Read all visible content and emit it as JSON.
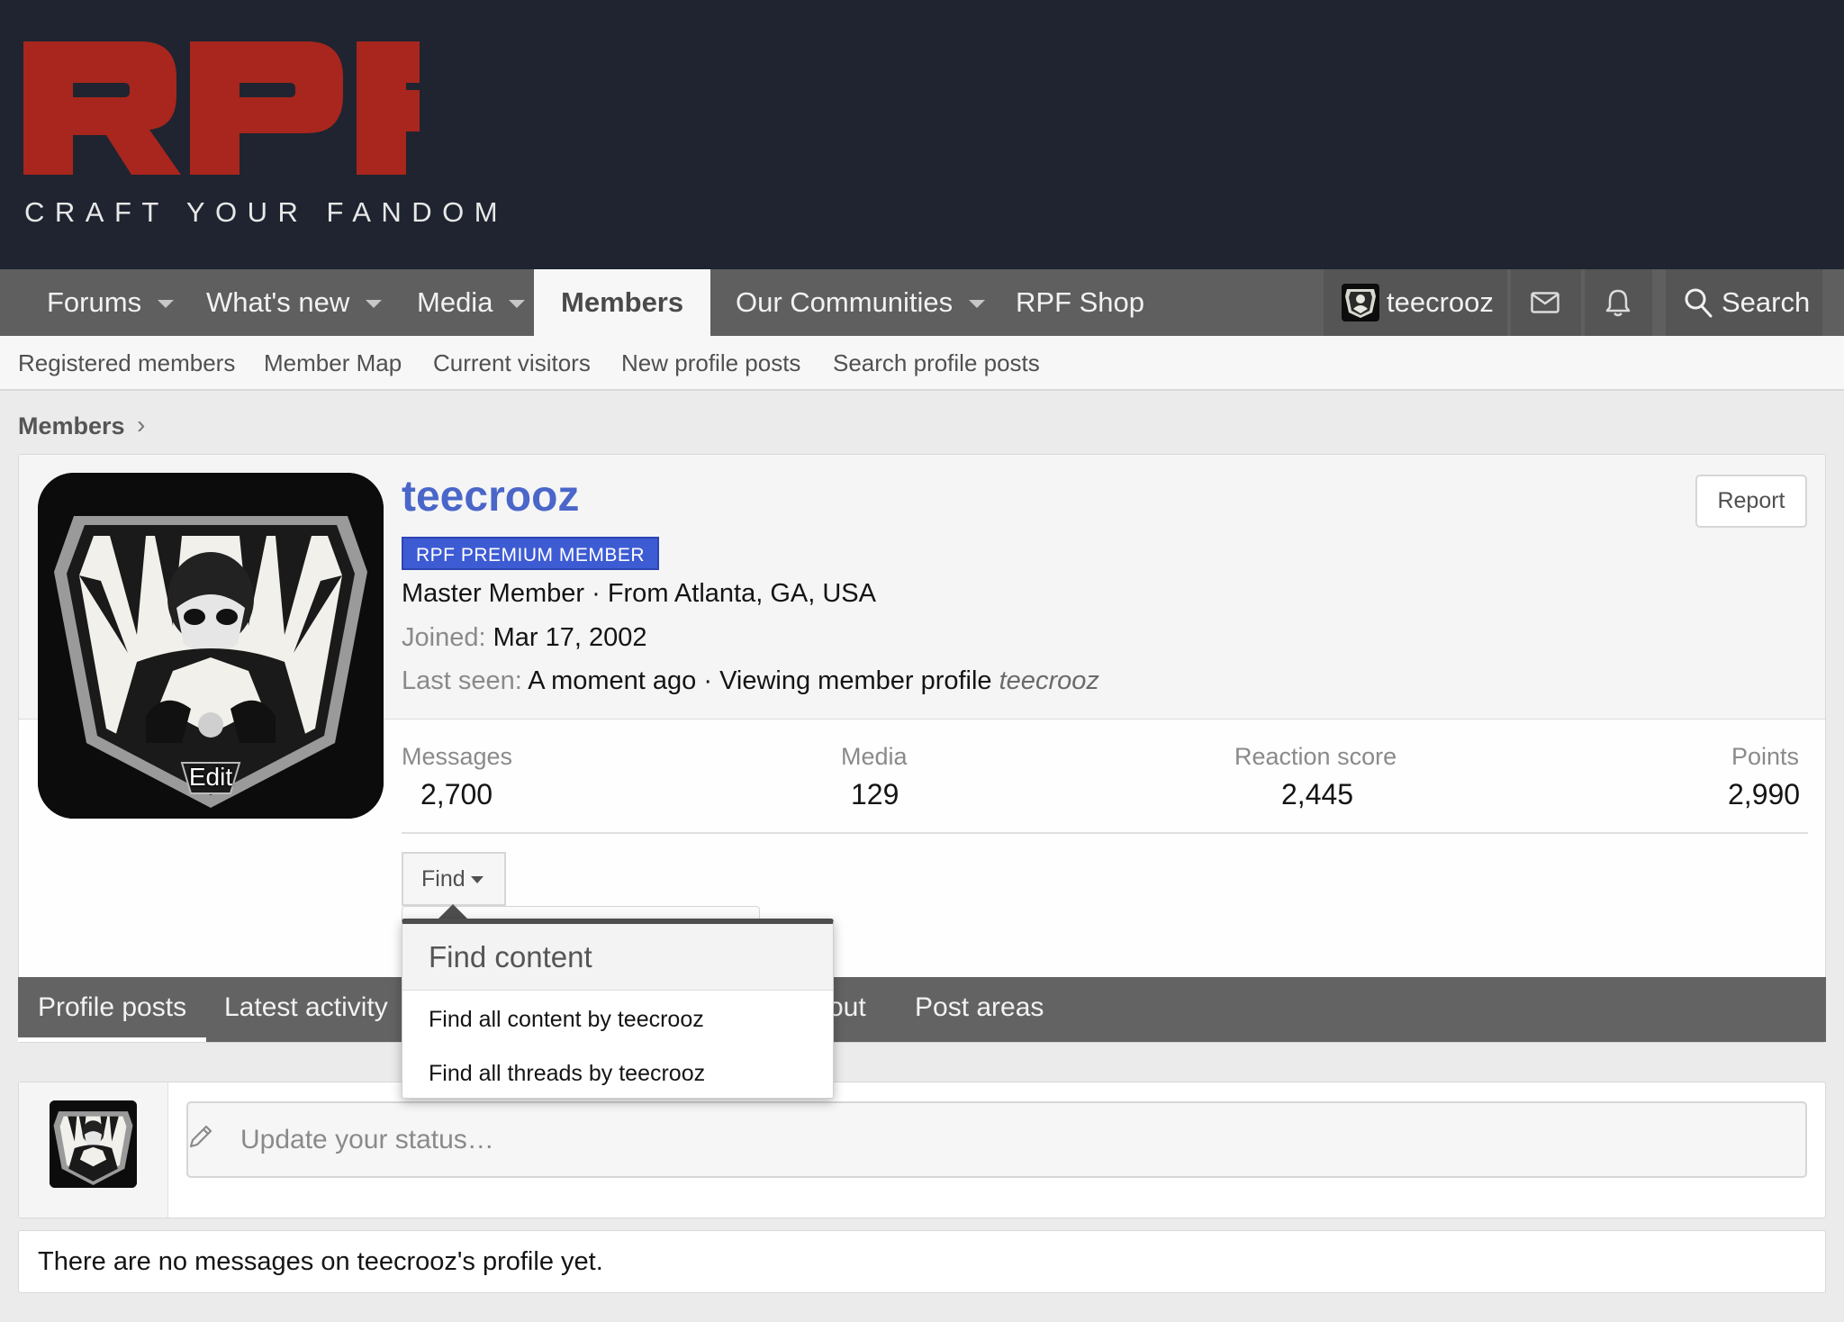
{
  "header": {
    "logo_text": "RPF",
    "tagline": "CRAFT YOUR FANDOM",
    "colors": {
      "background": "#1f2430",
      "logo_red": "#a8261d"
    }
  },
  "nav": {
    "tabs": [
      {
        "label": "Forums",
        "has_menu": true
      },
      {
        "label": "What's new",
        "has_menu": true
      },
      {
        "label": "Media",
        "has_menu": true
      },
      {
        "label": "Members",
        "active": true
      },
      {
        "label": "Our Communities",
        "has_menu": true
      },
      {
        "label": "RPF Shop"
      }
    ],
    "user": {
      "name": "teecrooz"
    },
    "search_label": "Search"
  },
  "subnav": {
    "items": [
      "Registered members",
      "Member Map",
      "Current visitors",
      "New profile posts",
      "Search profile posts"
    ]
  },
  "breadcrumb": {
    "items": [
      "Members"
    ]
  },
  "profile": {
    "username": "teecrooz",
    "banner": "RPF PREMIUM MEMBER",
    "title_line": "Master Member · From Atlanta, GA, USA",
    "joined_label": "Joined:",
    "joined_value": "Mar 17, 2002",
    "last_seen_label": "Last seen:",
    "last_seen_value": "A moment ago · Viewing member profile",
    "last_seen_target": "teecrooz",
    "avatar_edit_label": "Edit",
    "report_label": "Report",
    "stats": [
      {
        "label": "Messages",
        "value": "2,700"
      },
      {
        "label": "Media",
        "value": "129"
      },
      {
        "label": "Reaction score",
        "value": "2,445"
      },
      {
        "label": "Points",
        "value": "2,990"
      }
    ],
    "find_label": "Find",
    "tabs": [
      "Profile posts",
      "Latest activity",
      "About",
      "Post areas"
    ],
    "tabs_visible_partial": "out"
  },
  "find_menu": {
    "title": "Find content",
    "items": [
      "Find all content by teecrooz",
      "Find all threads by teecrooz"
    ]
  },
  "status": {
    "placeholder": "Update your status…"
  },
  "messages": {
    "empty_text": "There are no messages on teecrooz's profile yet."
  },
  "colors": {
    "nav": "#5f5f5f",
    "accent_blue": "#4a66c9",
    "banner_blue": "#3d5bd3"
  }
}
